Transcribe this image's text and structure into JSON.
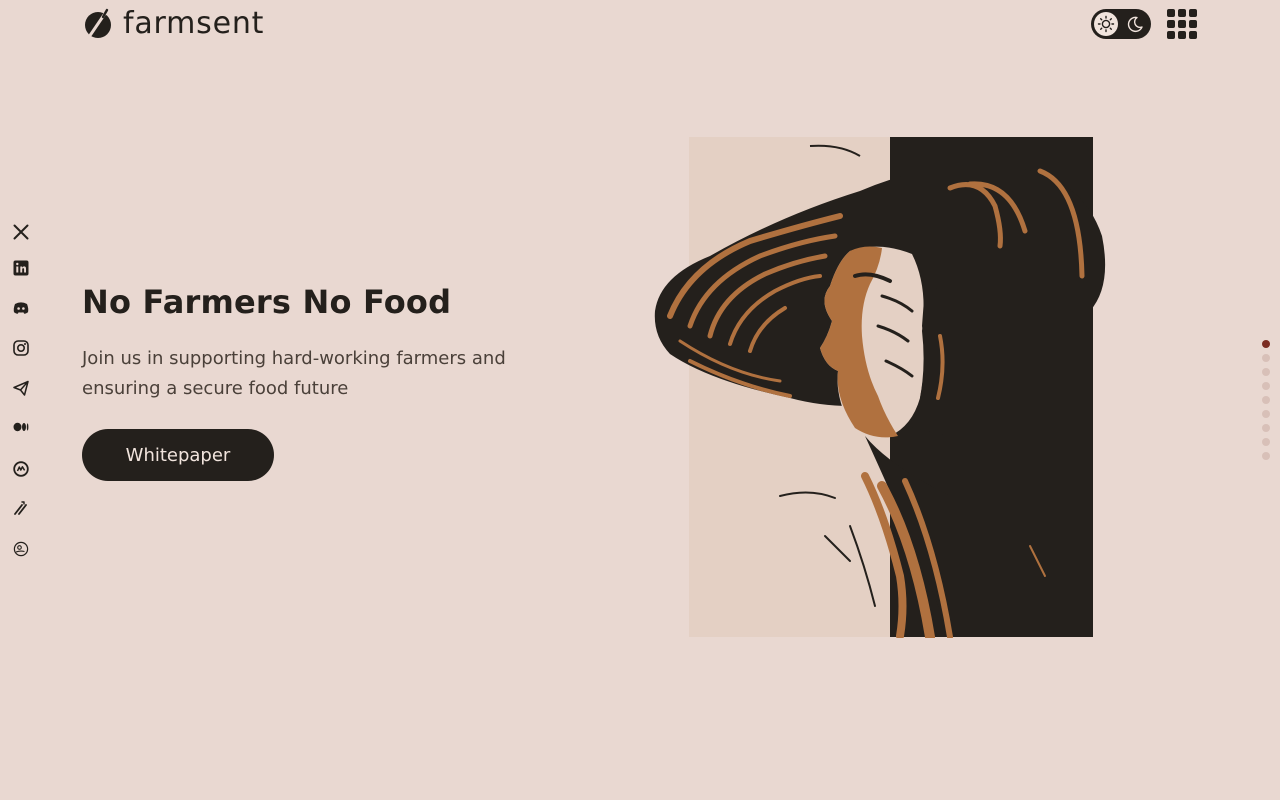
{
  "brand": {
    "name": "farmsent",
    "logo_icon": "farmsent-logo-icon"
  },
  "header": {
    "theme_toggle": {
      "mode": "light",
      "sun_icon": "sun-icon",
      "moon_icon": "moon-icon"
    },
    "apps_icon": "grid-menu-icon"
  },
  "hero": {
    "title": "No Farmers No Food",
    "subtitle": "Join us in supporting hard-working farmers and ensuring a secure food future",
    "cta_label": "Whitepaper"
  },
  "social_links": [
    {
      "id": "x",
      "icon": "x-twitter-icon"
    },
    {
      "id": "linkedin",
      "icon": "linkedin-icon"
    },
    {
      "id": "discord",
      "icon": "discord-icon"
    },
    {
      "id": "instagram",
      "icon": "instagram-icon"
    },
    {
      "id": "telegram",
      "icon": "telegram-icon"
    },
    {
      "id": "medium",
      "icon": "medium-icon"
    },
    {
      "id": "coinmarketcap",
      "icon": "coinmarketcap-icon"
    },
    {
      "id": "coingecko-like",
      "icon": "slash-logo-icon"
    },
    {
      "id": "coingecko",
      "icon": "coingecko-icon"
    }
  ],
  "pagination": {
    "total": 9,
    "active_index": 0
  },
  "colors": {
    "background": "#e9d8d1",
    "ink": "#24201c",
    "accent_brown": "#b0713f",
    "panel_beige": "#e4d0c4",
    "active_dot": "#7c2d22",
    "inactive_dot": "#d8c0b8"
  }
}
